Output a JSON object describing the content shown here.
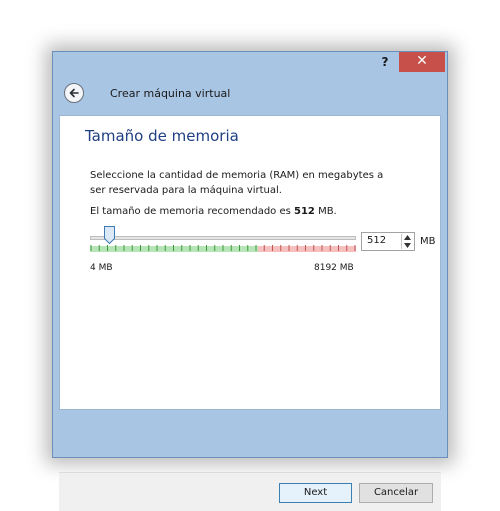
{
  "window": {
    "help_glyph": "?",
    "close_glyph": "✕"
  },
  "header": {
    "title": "Crear máquina virtual"
  },
  "page": {
    "heading": "Tamaño de memoria",
    "description": "Seleccione la cantidad de memoria (RAM) en megabytes a ser reservada para la máquina virtual.",
    "recommended_prefix": "El tamaño de memoria recomendado es ",
    "recommended_value": "512",
    "recommended_suffix": " MB."
  },
  "memory": {
    "value": "512",
    "unit": "MB",
    "min_label": "4 MB",
    "max_label": "8192 MB",
    "min": 4,
    "max": 8192,
    "current": 512,
    "safe_color": "#7ed07e",
    "warn_color": "#f08c8c"
  },
  "buttons": {
    "next_label": "Next",
    "cancel_label": "Cancelar"
  }
}
